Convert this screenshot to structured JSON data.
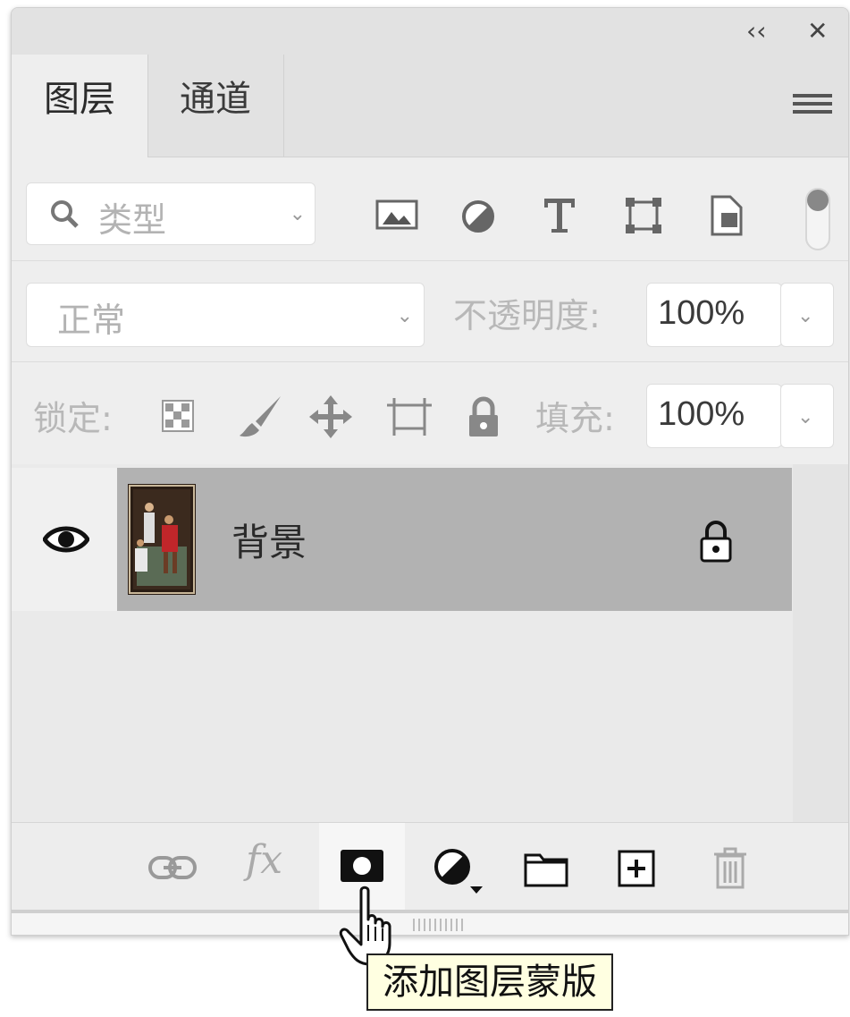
{
  "panel": {
    "collapse_label": "‹‹",
    "close_label": "✕",
    "tabs": [
      {
        "label": "图层"
      },
      {
        "label": "通道"
      }
    ]
  },
  "filter": {
    "placeholder": "类型",
    "icons": [
      "image-filter-icon",
      "adjustment-filter-icon",
      "type-filter-icon",
      "shape-filter-icon",
      "smart-object-filter-icon"
    ]
  },
  "blend": {
    "mode": "正常",
    "opacity_label": "不透明度:",
    "opacity_value": "100%"
  },
  "lock": {
    "label": "锁定:",
    "fill_label": "填充:",
    "fill_value": "100%"
  },
  "layers": [
    {
      "name": "背景",
      "visible": true,
      "locked": true
    }
  ],
  "bottom_icons": [
    "link-layers-icon",
    "fx-icon",
    "add-mask-icon",
    "adjustment-layer-icon",
    "folder-icon",
    "new-layer-icon",
    "trash-icon"
  ],
  "tooltip": "添加图层蒙版",
  "colors": {
    "selected_layer": "#b2b2b2",
    "panel_bg": "#eeeeee",
    "tooltip_bg": "#ffffe1"
  }
}
